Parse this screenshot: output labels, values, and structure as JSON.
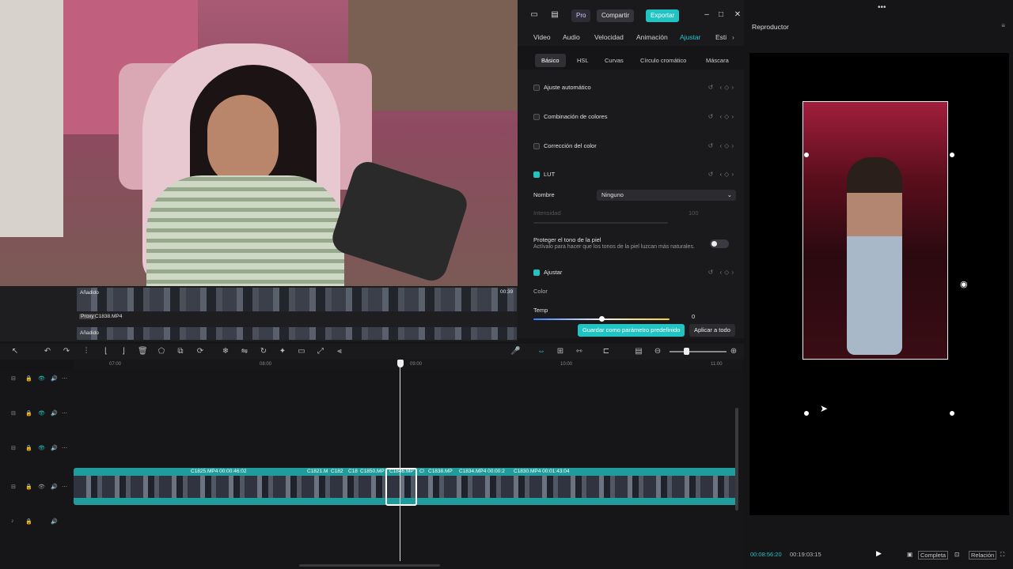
{
  "topbar": {
    "pro": "Pro",
    "share": "Compartir",
    "export": "Exportar"
  },
  "tabs": [
    {
      "label": "Video",
      "active": false
    },
    {
      "label": "Audio",
      "active": false
    },
    {
      "label": "Velocidad",
      "active": false
    },
    {
      "label": "Animación",
      "active": false
    },
    {
      "label": "Ajustar",
      "active": true
    },
    {
      "label": "Esti",
      "active": false
    }
  ],
  "subtabs": [
    {
      "label": "Básico",
      "active": true
    },
    {
      "label": "HSL",
      "active": false
    },
    {
      "label": "Curvas",
      "active": false
    },
    {
      "label": "Círculo cromático",
      "active": false
    },
    {
      "label": "Máscara",
      "active": false
    }
  ],
  "settings": {
    "auto_adjust": "Ajuste automático",
    "color_match": "Combinación de colores",
    "color_correction": "Corrección del color",
    "lut": "LUT",
    "name_label": "Nombre",
    "name_value": "Ninguno",
    "intensity_label": "Intensidad",
    "intensity_value": "100",
    "skin_title": "Proteger el tono de la piel",
    "skin_desc": "Actívalo para hacer que los tonos de la piel luzcan más naturales.",
    "adjust": "Ajustar",
    "color": "Color",
    "temp": "Temp",
    "temp_value": "0",
    "save_preset": "Guardar como parámetro predefinido",
    "apply_all": "Aplicar a todo"
  },
  "player": {
    "title": "Reproductor",
    "current_time": "00:08:56:20",
    "total_time": "00:19:03:15",
    "full": "Completa",
    "ratio": "Relación"
  },
  "media": {
    "added1": "Añadido",
    "duration": "00:39",
    "proxy": "Proxy",
    "file": "C1838.MP4",
    "added2": "Añadido"
  },
  "ruler": [
    "07:00",
    "08:00",
    "09:00",
    "10:00",
    "11:00"
  ],
  "clips": [
    {
      "label": "C1825.MP4  00:00:46:02"
    },
    {
      "label": "C1821.M"
    },
    {
      "label": "C182"
    },
    {
      "label": "C18"
    },
    {
      "label": "C1850.MP"
    },
    {
      "label": "C1846.MP"
    },
    {
      "label": "C!"
    },
    {
      "label": "C1838.MP"
    },
    {
      "label": "C1834.MP4  00:00:2"
    },
    {
      "label": "C1830.MP4  00:01:43:04"
    }
  ],
  "colors": {
    "accent": "#21c3c3",
    "track": "#1f9c9b",
    "bg": "#1a1a1c"
  }
}
